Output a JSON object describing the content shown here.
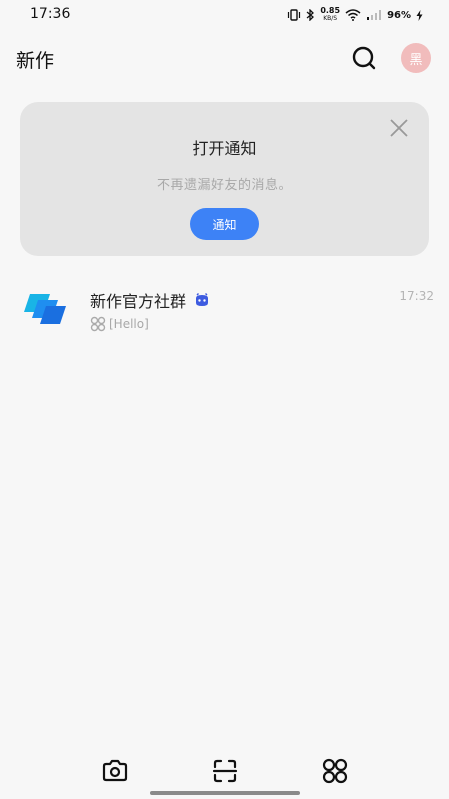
{
  "status": {
    "time": "17:36",
    "net_speed": "0.85",
    "net_unit": "KB/S",
    "battery": "96%"
  },
  "header": {
    "title": "新作",
    "avatar_text": "黑"
  },
  "notice": {
    "title": "打开通知",
    "description": "不再遗漏好友的消息。",
    "button_label": "通知"
  },
  "chats": [
    {
      "name": "新作官方社群",
      "preview": "[Hello]",
      "time": "17:32"
    }
  ],
  "colors": {
    "accent": "#3d82f6",
    "avatar_bg": "#f1bcbc",
    "card_bg": "#e4e4e4"
  }
}
